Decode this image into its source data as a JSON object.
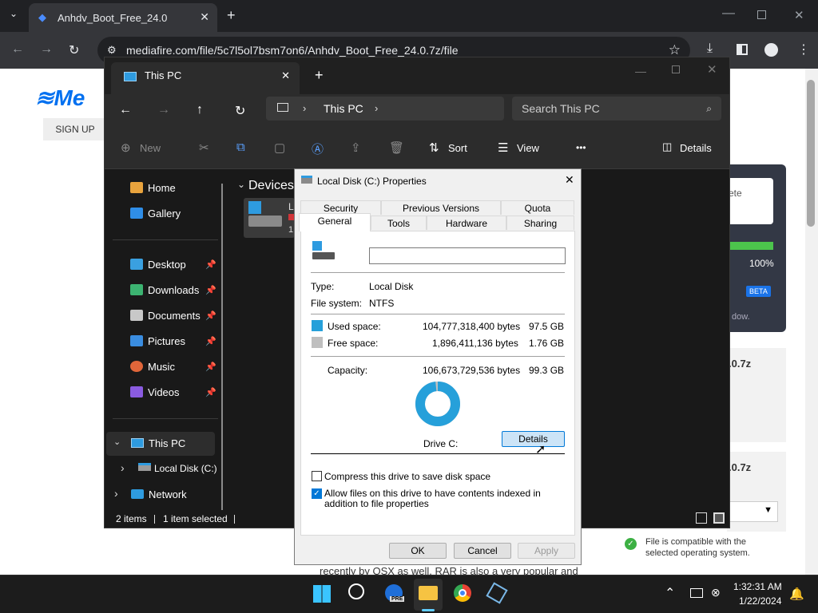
{
  "browser": {
    "tab_title": "Anhdv_Boot_Free_24.0",
    "url": "mediafire.com/file/5c7l5ol7bsm7on6/Anhdv_Boot_Free_24.0.7z/file",
    "new_tab": "+",
    "close": "✕"
  },
  "webpage": {
    "logo": "Me",
    "signup": "SIGN UP",
    "card_text": "ete",
    "progress_pct": "100%",
    "beta": "BETA",
    "dow": "dow.",
    "file1": ".0.7z",
    "file2": ".0.7z",
    "compat": "File is compatible with the selected operating system.",
    "body_text": "recently by OSX as well. RAR is also a very popular and"
  },
  "explorer": {
    "tab_title": "This PC",
    "address": "This PC",
    "search_placeholder": "Search This PC",
    "cmd": {
      "new": "New",
      "sort": "Sort",
      "view": "View",
      "more": "•••",
      "details": "Details"
    },
    "sidebar": [
      {
        "label": "Home",
        "pinned": false,
        "color": "#e8a33d"
      },
      {
        "label": "Gallery",
        "pinned": false,
        "color": "#2f8ee8"
      },
      {
        "label": "Desktop",
        "pinned": true,
        "color": "#3aa0e0"
      },
      {
        "label": "Downloads",
        "pinned": true,
        "color": "#3cb371"
      },
      {
        "label": "Documents",
        "pinned": true,
        "color": "#c8c8c8"
      },
      {
        "label": "Pictures",
        "pinned": true,
        "color": "#3a8de0"
      },
      {
        "label": "Music",
        "pinned": true,
        "color": "#e0663a"
      },
      {
        "label": "Videos",
        "pinned": true,
        "color": "#8a5be0"
      }
    ],
    "tree": {
      "this_pc": "This PC",
      "local_disk": "Local Disk (C:)",
      "network": "Network"
    },
    "section": "Devices",
    "drive_initial": "L",
    "drive_num": "1",
    "status": {
      "items": "2 items",
      "selected": "1 item selected"
    }
  },
  "dialog": {
    "title": "Local Disk (C:) Properties",
    "tabs_top": [
      "Security",
      "Previous Versions",
      "Quota"
    ],
    "tabs_bottom": [
      "General",
      "Tools",
      "Hardware",
      "Sharing"
    ],
    "type_label": "Type:",
    "type_value": "Local Disk",
    "fs_label": "File system:",
    "fs_value": "NTFS",
    "used_label": "Used space:",
    "used_bytes": "104,777,318,400 bytes",
    "used_gb": "97.5 GB",
    "free_label": "Free space:",
    "free_bytes": "1,896,411,136 bytes",
    "free_gb": "1.76 GB",
    "cap_label": "Capacity:",
    "cap_bytes": "106,673,729,536 bytes",
    "cap_gb": "99.3 GB",
    "used_fraction": 0.982,
    "drive_label": "Drive C:",
    "details_btn": "Details",
    "compress_label": "Compress this drive to save disk space",
    "index_label": "Allow files on this drive to have contents indexed in addition to file properties",
    "ok": "OK",
    "cancel": "Cancel",
    "apply": "Apply",
    "used_color": "#26a0da",
    "free_color": "#bfbfbf"
  },
  "taskbar": {
    "time": "1:32:31 AM",
    "date": "1/22/2024",
    "pre_badge": "PRE"
  }
}
